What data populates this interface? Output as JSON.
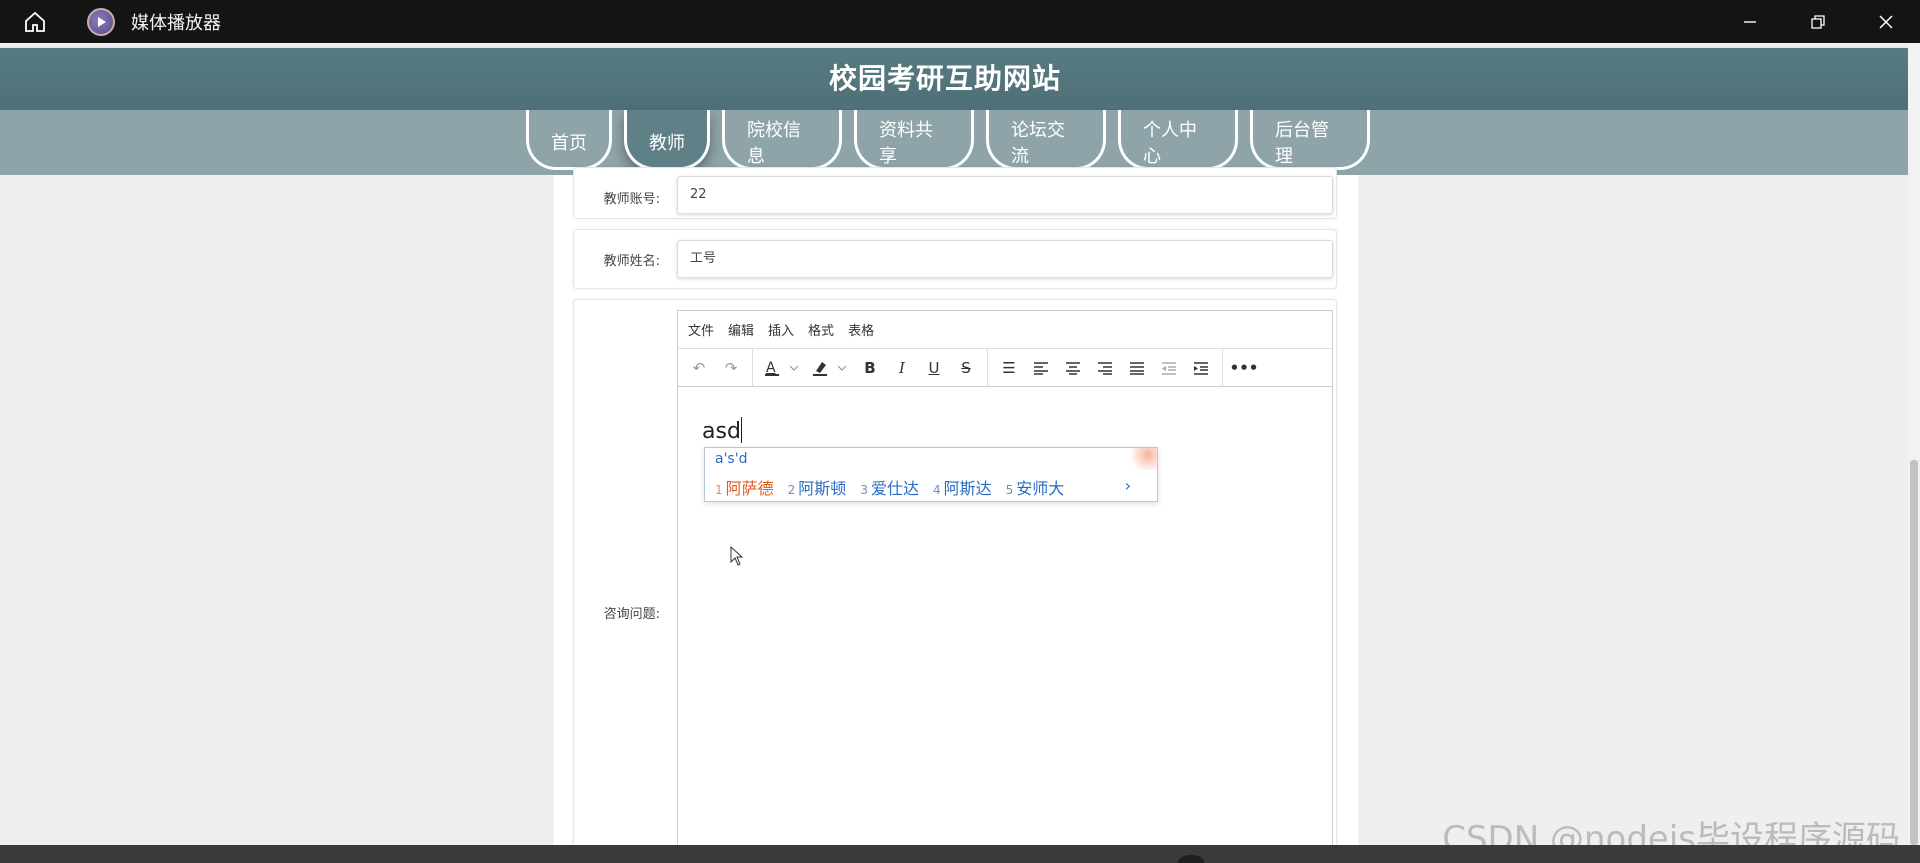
{
  "window": {
    "title": "媒体播放器"
  },
  "site": {
    "title": "校园考研互助网站",
    "nav": [
      "首页",
      "教师",
      "院校信息",
      "资料共享",
      "论坛交流",
      "个人中心",
      "后台管理"
    ],
    "active_nav": "教师"
  },
  "form": {
    "account_label": "教师账号:",
    "account_value": "22",
    "name_label": "教师姓名:",
    "name_value": "工号",
    "question_label": "咨询问题:"
  },
  "editor": {
    "menus": [
      "文件",
      "编辑",
      "插入",
      "格式",
      "表格"
    ],
    "content": "asd"
  },
  "ime": {
    "composition": "a's'd",
    "candidates": [
      {
        "num": "1",
        "text": "阿萨德"
      },
      {
        "num": "2",
        "text": "阿斯顿"
      },
      {
        "num": "3",
        "text": "爱仕达"
      },
      {
        "num": "4",
        "text": "阿斯达"
      },
      {
        "num": "5",
        "text": "安师大"
      }
    ],
    "next": "›"
  },
  "watermark": "CSDN @nodejs毕设程序源码"
}
